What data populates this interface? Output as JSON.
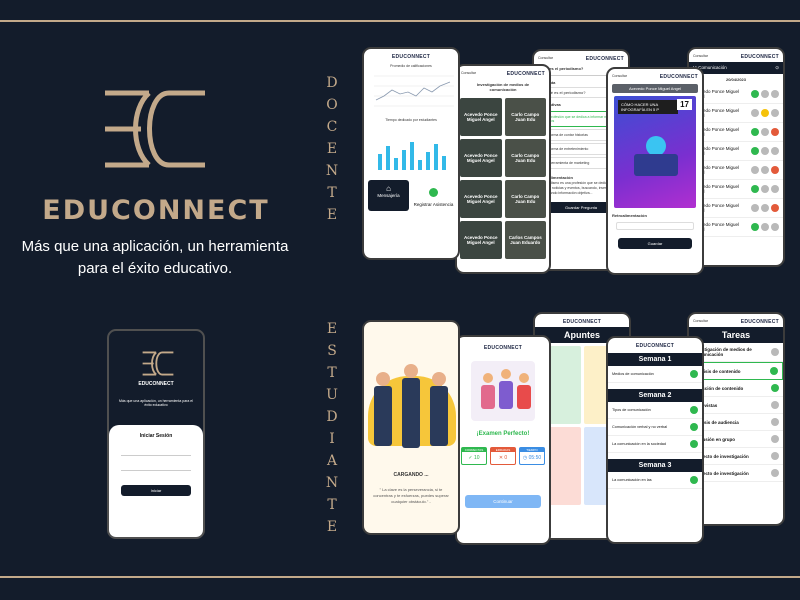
{
  "brand": {
    "name": "EDUCONNECT",
    "tagline_line1": "Más que una aplicación, un herramienta",
    "tagline_line2": "para el éxito educativo."
  },
  "sections": {
    "docente": [
      "D",
      "O",
      "C",
      "E",
      "N",
      "T",
      "E"
    ],
    "estudiante": [
      "E",
      "S",
      "T",
      "U",
      "D",
      "I",
      "A",
      "N",
      "T",
      "E"
    ]
  },
  "colors": {
    "background": "#131c2b",
    "accent": "#c3a98a",
    "success": "#2fb84f"
  },
  "docente_screens": {
    "dashboard": {
      "app_name": "EDUCONNECT",
      "chart1_title": "Promedio de calificaciones",
      "chart2_title": "Tiempo dedicado por estudiantes",
      "button_messages": "Mensajería",
      "button_attendance": "Registrar Asistencia"
    },
    "students": {
      "header": "Investigación de medios de comunicación",
      "cards": [
        "Acevedo Ponce Miguel Angel",
        "Acevedo Ponce Miguel Angel",
        "Acevedo Ponce Miguel Angel",
        "Acevedo Ponce Miguel Angel"
      ],
      "cards_right": [
        "Carlo Campo Juan Edu",
        "Carlo Campo Juan Edu",
        "Carlo Campo Juan Edu",
        "Carlos Campos Juan Eduardo"
      ]
    },
    "quiz_editor": {
      "label_question": "Pregunta",
      "question": "¿Qué es el periodismo?",
      "label_alternatives": "Alternativas",
      "alternatives": [
        "Una profesión que se dedica a informar noticias y eventos",
        "Una forma de contar historias",
        "Una forma de entretenimiento",
        "Una herramienta de marketing"
      ],
      "label_feedback": "Retroalimentación",
      "button": "Guardar Pregunta"
    },
    "upload": {
      "name": "Acevedo Ponce Miguel Angel",
      "banner": "CÓMO HACER UNA INFOGRAFÍA EN 5 P",
      "day": "17",
      "label_feedback": "Retroalimentación",
      "button": "Guardar"
    },
    "attendance": {
      "subject": "IA Comunicación",
      "date": "20/04/2023",
      "names": [
        "Acevedo Ponce Miguel Angel",
        "Acevedo Ponce Miguel Angel",
        "Acevedo Ponce Miguel Angel",
        "Acevedo Ponce Miguel Angel",
        "Acevedo Ponce Miguel Angel",
        "Acevedo Ponce Miguel Angel",
        "Acevedo Ponce Miguel Angel",
        "Acevedo Ponce Miguel Angel"
      ]
    }
  },
  "estudiante_screens": {
    "login": {
      "brand": "EDUCONNECT",
      "tagline": "Más que una aplicación, un herramienta para el éxito educativo",
      "title": "Iniciar Sesión",
      "button": "Iniciar"
    },
    "loading": {
      "status": "CARGANDO ...",
      "quote": "\" La clave es la perseverancia, si te concentras y te esfuerzas, puedes superar cualquier obstáculo.\" - "
    },
    "result": {
      "app_name": "EDUCONNECT",
      "title": "¡Examen Perfecto!",
      "label_correct": "CORRECTAS",
      "label_wrong": "ERRADAS",
      "label_time": "TIEMPO",
      "correct": "10",
      "wrong": "0",
      "time": "05:50",
      "button": "Continuar"
    },
    "notes": {
      "app_name": "EDUCONNECT",
      "title": "Apuntes"
    },
    "weeks": {
      "app_name": "EDUCONNECT",
      "week1": "Semana 1",
      "week1_items": [
        "Medios de comunicación"
      ],
      "week2": "Semana 2",
      "week2_items": [
        "Tipos de comunicación",
        "Comunicación verbal y no verbal",
        "La comunicación en la sociedad"
      ],
      "week3": "Semana 3",
      "week3_items": [
        "La comunicación en las"
      ]
    },
    "tasks": {
      "app_name": "EDUCONNECT",
      "title": "Tareas",
      "items": [
        "Investigación de medios de comunicación",
        "Análisis de contenido",
        "Selección de contenido",
        "Entrevistas",
        "Análisis de audiencia",
        "Discusión en grupo",
        "Proyecto de investigación",
        "Proyecto de investigación"
      ]
    }
  }
}
